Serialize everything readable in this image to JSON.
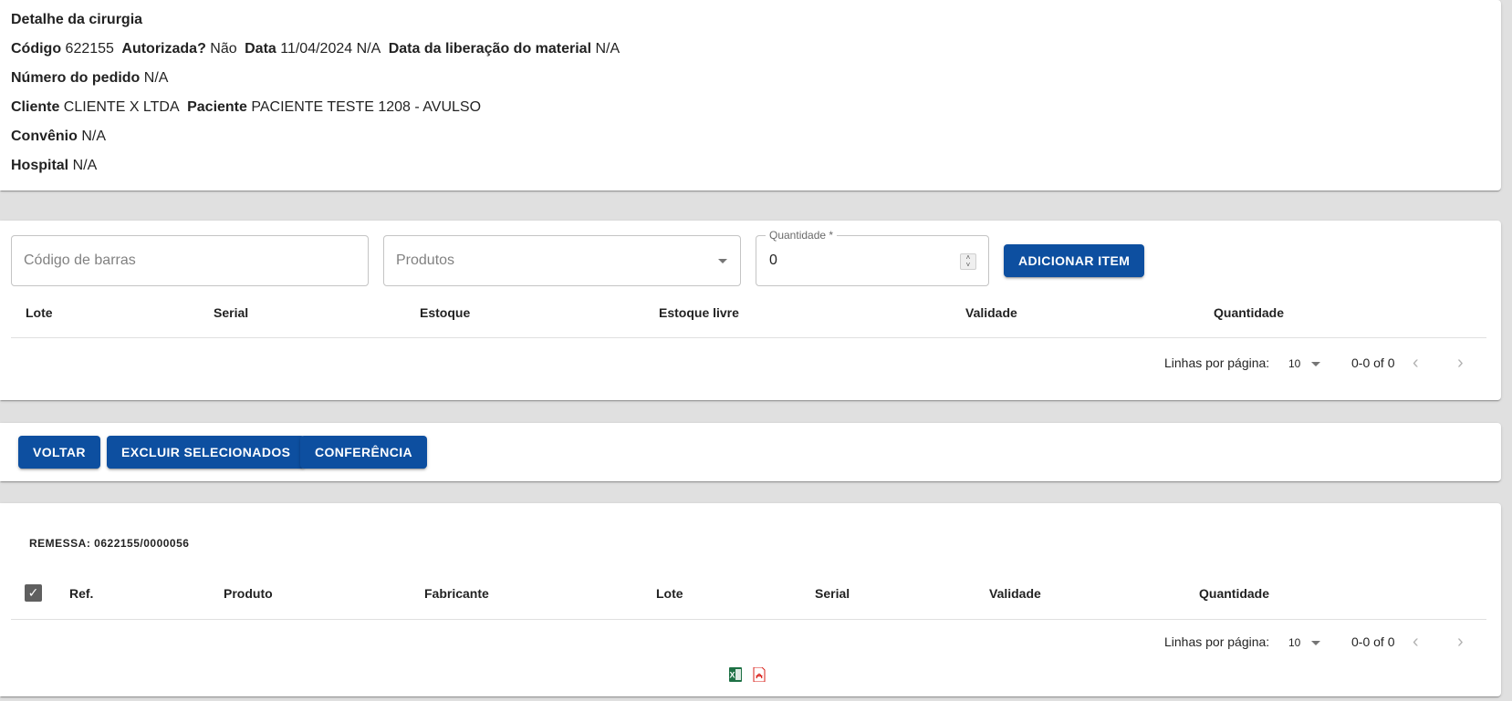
{
  "details": {
    "title": "Detalhe da cirurgia",
    "codigo_label": "Código",
    "codigo_value": "622155",
    "autorizada_label": "Autorizada?",
    "autorizada_value": "Não",
    "data_label": "Data",
    "data_value": "11/04/2024 N/A",
    "liberacao_label": "Data da liberação do material",
    "liberacao_value": "N/A",
    "pedido_label": "Número do pedido",
    "pedido_value": "N/A",
    "cliente_label": "Cliente",
    "cliente_value": "CLIENTE X LTDA",
    "paciente_label": "Paciente",
    "paciente_value": "PACIENTE TESTE 1208 - AVULSO",
    "convenio_label": "Convênio",
    "convenio_value": "N/A",
    "hospital_label": "Hospital",
    "hospital_value": "N/A"
  },
  "add_item": {
    "barcode_placeholder": "Código de barras",
    "produtos_placeholder": "Produtos",
    "quantidade_label": "Quantidade *",
    "quantidade_value": "0",
    "add_button": "ADICIONAR ITEM",
    "columns": [
      "Lote",
      "Serial",
      "Estoque",
      "Estoque livre",
      "Validade",
      "Quantidade"
    ],
    "pager": {
      "rows_label": "Linhas por página:",
      "rows_value": "10",
      "range": "0-0 of 0"
    }
  },
  "actions": {
    "voltar": "VOLTAR",
    "excluir": "EXCLUIR SELECIONADOS",
    "conferencia": "CONFERÊNCIA"
  },
  "remessa": {
    "title": "REMESSA: 0622155/0000056",
    "columns": [
      "Ref.",
      "Produto",
      "Fabricante",
      "Lote",
      "Serial",
      "Validade",
      "Quantidade"
    ],
    "pager": {
      "rows_label": "Linhas por página:",
      "rows_value": "10",
      "range": "0-0 of 0"
    }
  },
  "icons": {
    "excel": "excel-export-icon",
    "pdf": "pdf-export-icon"
  },
  "colors": {
    "primary": "#0d4fa0",
    "background": "#e0e0e0",
    "excel_green": "#1e7145",
    "pdf_red": "#d9211b"
  }
}
